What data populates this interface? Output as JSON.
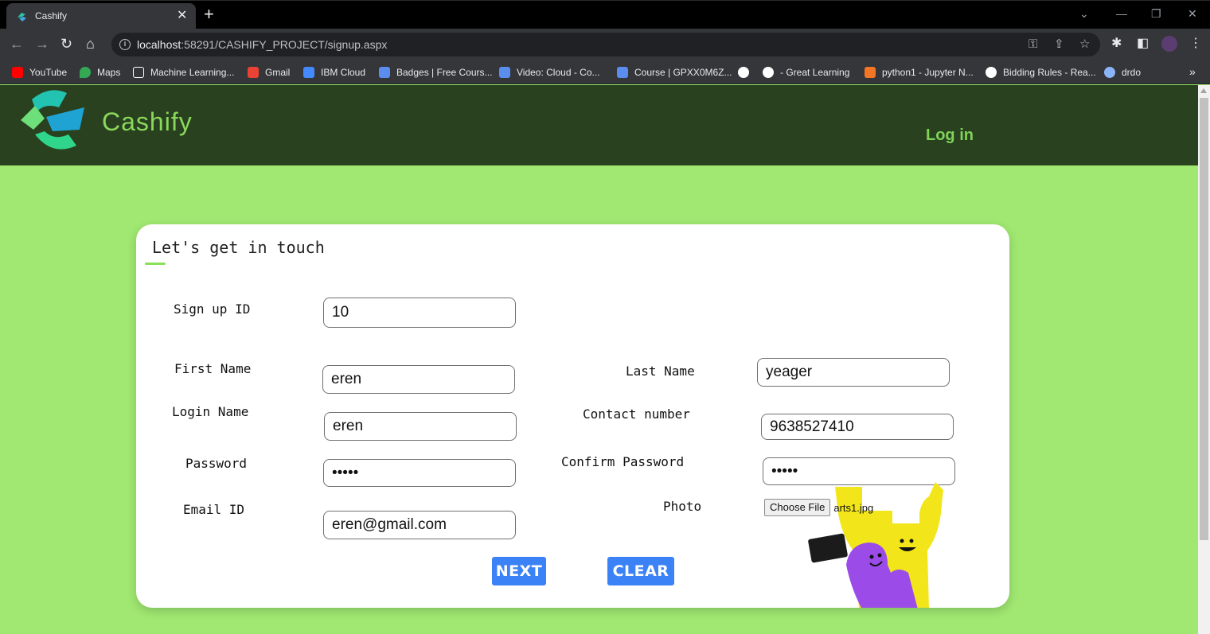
{
  "browser": {
    "tab_title": "Cashify",
    "url_host": "localhost",
    "url_rest": ":58291/CASHIFY_PROJECT/signup.aspx",
    "bookmarks": [
      {
        "label": "YouTube",
        "icon": "youtube-icon",
        "color": "#ff0000"
      },
      {
        "label": "Maps",
        "icon": "maps-icon",
        "color": "#34a853"
      },
      {
        "label": "Machine Learning...",
        "icon": "ml-icon",
        "color": "#ffffff"
      },
      {
        "label": "Gmail",
        "icon": "gmail-icon",
        "color": "#ea4335"
      },
      {
        "label": "IBM Cloud",
        "icon": "ibm-cloud-icon",
        "color": "#4589ff"
      },
      {
        "label": "Badges | Free Cours...",
        "icon": "course-icon",
        "color": "#5a8dee"
      },
      {
        "label": "Video: Cloud - Co...",
        "icon": "course-icon",
        "color": "#5a8dee"
      },
      {
        "label": "Course | GPXX0M6Z...",
        "icon": "course-icon",
        "color": "#5a8dee"
      },
      {
        "label": "",
        "icon": "globe-icon",
        "color": "#ffffff"
      },
      {
        "label": "- Great Learning",
        "icon": "google-icon",
        "color": "#ffffff"
      },
      {
        "label": "python1 - Jupyter N...",
        "icon": "jupyter-icon",
        "color": "#f37626"
      },
      {
        "label": "Bidding Rules - Rea...",
        "icon": "globe-icon",
        "color": "#ffffff"
      },
      {
        "label": "drdo",
        "icon": "drdo-icon",
        "color": "#8ab4f8"
      }
    ]
  },
  "header": {
    "brand": "Cashify",
    "login": "Log in"
  },
  "form": {
    "title": "Let's get in touch",
    "signup_id": {
      "label": "Sign up ID",
      "value": "10"
    },
    "first_name": {
      "label": "First Name",
      "value": "eren"
    },
    "last_name": {
      "label": "Last Name",
      "value": "yeager"
    },
    "login_name": {
      "label": "Login Name",
      "value": "eren"
    },
    "contact": {
      "label": "Contact number",
      "value": "9638527410"
    },
    "password": {
      "label": "Password",
      "value": "erenn"
    },
    "confirm_password": {
      "label": "Confirm Password",
      "value": "erenn"
    },
    "email": {
      "label": "Email ID",
      "value": "eren@gmail.com"
    },
    "photo": {
      "label": "Photo",
      "button": "Choose File",
      "file": "arts1.jpg"
    },
    "next": "NEXT",
    "clear": "CLEAR"
  },
  "colors": {
    "page_bg": "#a0e871",
    "header_bg": "#29411f",
    "accent_green": "#8ad85c",
    "button_blue": "#3b82f6"
  }
}
